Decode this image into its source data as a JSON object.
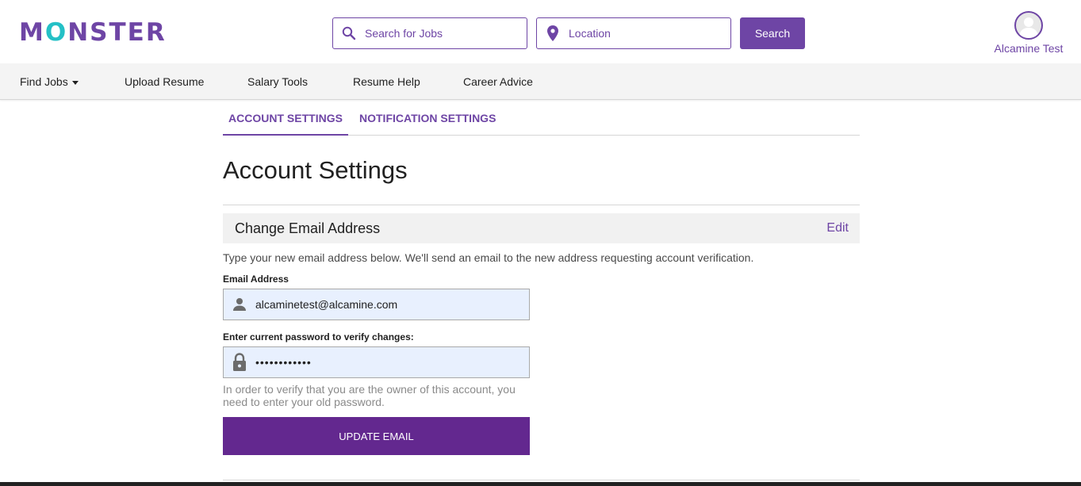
{
  "header": {
    "logo_text": "MONSTER",
    "search_jobs_placeholder": "Search for Jobs",
    "location_placeholder": "Location",
    "search_button": "Search",
    "user_name": "Alcamine Test"
  },
  "nav": {
    "items": [
      {
        "label": "Find Jobs"
      },
      {
        "label": "Upload Resume"
      },
      {
        "label": "Salary Tools"
      },
      {
        "label": "Resume Help"
      },
      {
        "label": "Career Advice"
      }
    ]
  },
  "tabs": [
    {
      "label": "ACCOUNT SETTINGS",
      "active": true
    },
    {
      "label": "NOTIFICATION SETTINGS",
      "active": false
    }
  ],
  "page": {
    "title": "Account Settings",
    "section_title": "Change Email Address",
    "edit_label": "Edit",
    "description": "Type your new email address below. We'll send an email to the new address requesting account verification.",
    "email_label": "Email Address",
    "email_value": "alcaminetest@alcamine.com",
    "password_label": "Enter current password to verify changes:",
    "password_mask": "••••••••••••",
    "help_text": "In order to verify that you are the owner of this account, you need to enter your old password.",
    "update_button": "UPDATE EMAIL"
  },
  "colors": {
    "brand_purple": "#6e45a5",
    "button_purple": "#63288f",
    "logo_accent": "#24c0c6",
    "autofill_bg": "#e8f0fe"
  }
}
